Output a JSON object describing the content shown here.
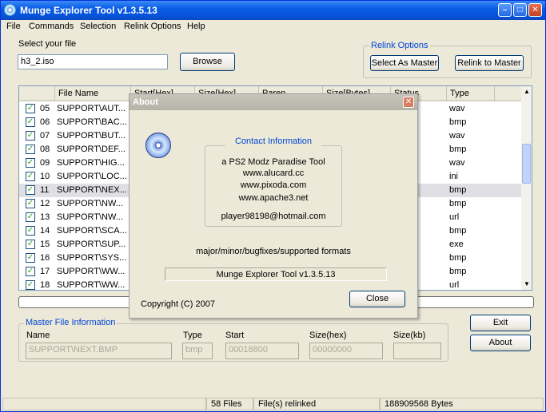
{
  "window": {
    "title": "Munge Explorer Tool v1.3.5.13"
  },
  "menu": [
    "File",
    "Commands",
    "Selection",
    "Relink Options",
    "Help"
  ],
  "file_section": {
    "label": "Select your file",
    "value": "h3_2.iso",
    "browse": "Browse"
  },
  "relink": {
    "title": "Relink Options",
    "select_as_master": "Select As Master",
    "relink_to_master": "Relink to Master"
  },
  "list": {
    "columns": [
      "File Name",
      "Start[Hex]",
      "Size[Hex]",
      "Paren...",
      "Size[Bytes]",
      "Status",
      "Type"
    ],
    "rows": [
      {
        "num": "05",
        "name": "SUPPORT\\AUT...",
        "type": "wav"
      },
      {
        "num": "06",
        "name": "SUPPORT\\BAC...",
        "type": "bmp"
      },
      {
        "num": "07",
        "name": "SUPPORT\\BUT...",
        "type": "wav"
      },
      {
        "num": "08",
        "name": "SUPPORT\\DEF...",
        "type": "bmp"
      },
      {
        "num": "09",
        "name": "SUPPORT\\HIG...",
        "type": "wav"
      },
      {
        "num": "10",
        "name": "SUPPORT\\LOC...",
        "type": "ini"
      },
      {
        "num": "11",
        "name": "SUPPORT\\NEX...",
        "type": "bmp"
      },
      {
        "num": "12",
        "name": "SUPPORT\\NW...",
        "type": "bmp"
      },
      {
        "num": "13",
        "name": "SUPPORT\\NW...",
        "type": "url"
      },
      {
        "num": "14",
        "name": "SUPPORT\\SCA...",
        "type": "bmp"
      },
      {
        "num": "15",
        "name": "SUPPORT\\SUP...",
        "type": "exe"
      },
      {
        "num": "16",
        "name": "SUPPORT\\SYS...",
        "type": "bmp"
      },
      {
        "num": "17",
        "name": "SUPPORT\\WW...",
        "type": "bmp"
      },
      {
        "num": "18",
        "name": "SUPPORT\\WW...",
        "type": "url"
      }
    ]
  },
  "master": {
    "title": "Master File Information",
    "name_label": "Name",
    "name_value": "SUPPORT\\NEXT.BMP",
    "type_label": "Type",
    "type_value": "bmp",
    "start_label": "Start",
    "start_value": "00018800",
    "sizehex_label": "Size(hex)",
    "sizehex_value": "00000000",
    "sizekb_label": "Size(kb)",
    "sizekb_value": ""
  },
  "buttons": {
    "exit": "Exit",
    "about": "About"
  },
  "status": {
    "files": "58 Files",
    "relinked": "File(s) relinked",
    "bytes": "188909568 Bytes"
  },
  "about": {
    "title": "About",
    "contact_title": "Contact Information",
    "line1": "a PS2 Modz Paradise Tool",
    "line2": "www.alucard.cc",
    "line3": "www.pixoda.com",
    "line4": "www.apache3.net",
    "email": "player98198@hotmail.com",
    "version_format": "major/minor/bugfixes/supported formats",
    "version": "Munge Explorer Tool v1.3.5.13",
    "copyright": "Copyright (C) 2007",
    "close": "Close"
  }
}
